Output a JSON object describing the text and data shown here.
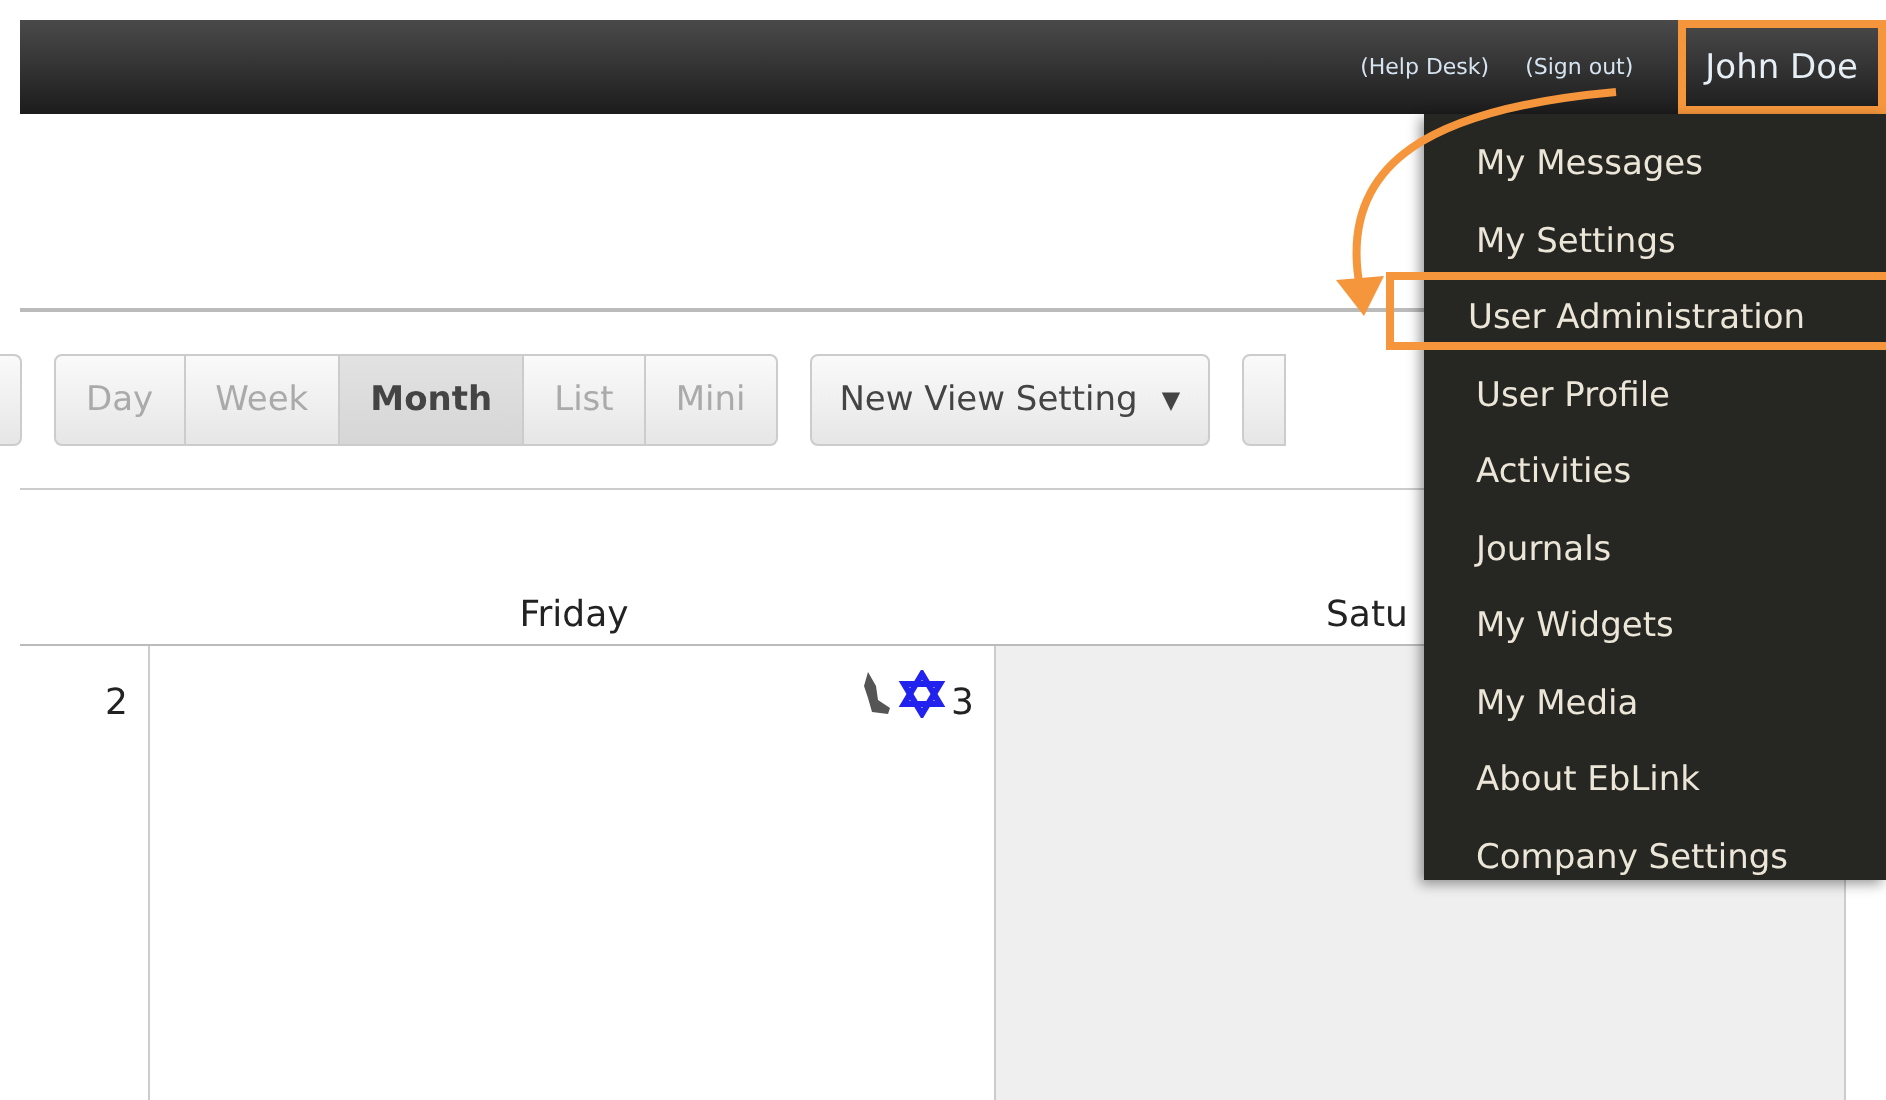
{
  "top_bar": {
    "links": [
      "(Help Desk)",
      "(Sign out)"
    ],
    "user": {
      "label": "John Doe",
      "highlighted": true
    }
  },
  "user_menu": {
    "items": [
      {
        "label": "My Messages",
        "highlighted": false
      },
      {
        "label": "My Settings",
        "highlighted": false
      },
      {
        "label": "User Administration",
        "highlighted": true
      },
      {
        "label": "User Profile",
        "highlighted": false
      },
      {
        "label": "Activities",
        "highlighted": false
      },
      {
        "label": "Journals",
        "highlighted": false
      },
      {
        "label": "My Widgets",
        "highlighted": false
      },
      {
        "label": "My Media",
        "highlighted": false
      },
      {
        "label": "About EbLink",
        "highlighted": false
      },
      {
        "label": "Company Settings",
        "highlighted": false
      }
    ]
  },
  "view_buttons": [
    {
      "label": "Day",
      "selected": false
    },
    {
      "label": "Week",
      "selected": false
    },
    {
      "label": "Month",
      "selected": true
    },
    {
      "label": "List",
      "selected": false
    },
    {
      "label": "Mini",
      "selected": false
    }
  ],
  "view_setting": {
    "label": "New View Setting",
    "caret": "▼"
  },
  "calendar": {
    "columns": [
      "Friday",
      "Satu"
    ],
    "cells": [
      {
        "day": "2",
        "kind": "plain"
      },
      {
        "day": "3",
        "kind": "icons"
      }
    ]
  }
}
